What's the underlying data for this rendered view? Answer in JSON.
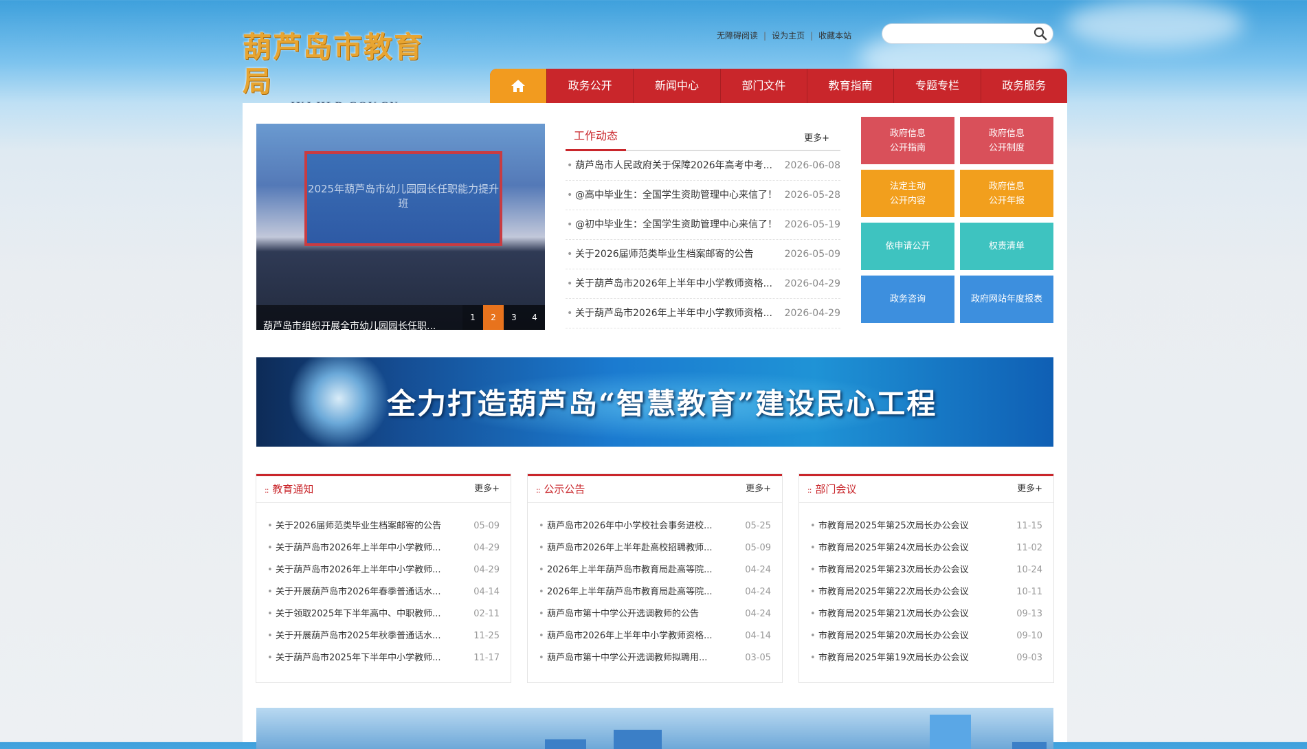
{
  "header": {
    "logo_cn": "葫芦岛市教育局",
    "logo_en": "JYJ.HLD.GOV.CN",
    "links": [
      "无障碍阅读",
      "设为主页",
      "收藏本站"
    ],
    "search_placeholder": ""
  },
  "nav": {
    "home_icon": "home-icon",
    "items": [
      "政务公开",
      "新闻中心",
      "部门文件",
      "教育指南",
      "专题专栏",
      "政务服务"
    ]
  },
  "slider": {
    "screen_text": "2025年葫芦岛市幼儿园园长任职能力提升班",
    "caption": "葫芦岛市组织开展全市幼儿园园长任职...",
    "pages": [
      "1",
      "2",
      "3",
      "4"
    ],
    "active_page": "2"
  },
  "news": {
    "tab": "工作动态",
    "more": "更多+",
    "items": [
      {
        "title": "葫芦岛市人民政府关于保障2026年高考中考...",
        "date": "2026-06-08"
      },
      {
        "title": "@高中毕业生：全国学生资助管理中心来信了！",
        "date": "2026-05-28"
      },
      {
        "title": "@初中毕业生：全国学生资助管理中心来信了！",
        "date": "2026-05-19"
      },
      {
        "title": "关于2026届师范类毕业生档案邮寄的公告",
        "date": "2026-05-09"
      },
      {
        "title": "关于葫芦岛市2026年上半年中小学教师资格...",
        "date": "2026-04-29"
      },
      {
        "title": "关于葫芦岛市2026年上半年中小学教师资格...",
        "date": "2026-04-29"
      }
    ]
  },
  "quick_links": [
    {
      "line1": "政府信息",
      "line2": "公开指南",
      "color": "#d9505a"
    },
    {
      "line1": "政府信息",
      "line2": "公开制度",
      "color": "#d9505a"
    },
    {
      "line1": "法定主动",
      "line2": "公开内容",
      "color": "#f29f1d"
    },
    {
      "line1": "政府信息",
      "line2": "公开年报",
      "color": "#f29f1d"
    },
    {
      "line1": "依申请公开",
      "line2": "",
      "color": "#3ec3c0"
    },
    {
      "line1": "权责清单",
      "line2": "",
      "color": "#3ec3c0"
    },
    {
      "line1": "政务咨询",
      "line2": "",
      "color": "#3d8fde"
    },
    {
      "line1": "政府网站年度报表",
      "line2": "",
      "color": "#3d8fde"
    }
  ],
  "banner": {
    "text": "全力打造葫芦岛“智慧教育”建设民心工程"
  },
  "boxes": [
    {
      "title": "教育通知",
      "more": "更多+",
      "items": [
        {
          "title": "关于2026届师范类毕业生档案邮寄的公告",
          "date": "05-09"
        },
        {
          "title": "关于葫芦岛市2026年上半年中小学教师...",
          "date": "04-29"
        },
        {
          "title": "关于葫芦岛市2026年上半年中小学教师...",
          "date": "04-29"
        },
        {
          "title": "关于开展葫芦岛市2026年春季普通话水...",
          "date": "04-14"
        },
        {
          "title": "关于领取2025年下半年高中、中职教师...",
          "date": "02-11"
        },
        {
          "title": "关于开展葫芦岛市2025年秋季普通话水...",
          "date": "11-25"
        },
        {
          "title": "关于葫芦岛市2025年下半年中小学教师...",
          "date": "11-17"
        }
      ]
    },
    {
      "title": "公示公告",
      "more": "更多+",
      "items": [
        {
          "title": "葫芦岛市2026年中小学校社会事务进校...",
          "date": "05-25"
        },
        {
          "title": "葫芦岛市2026年上半年赴高校招聘教师...",
          "date": "05-09"
        },
        {
          "title": "2026年上半年葫芦岛市教育局赴高等院...",
          "date": "04-24"
        },
        {
          "title": "2026年上半年葫芦岛市教育局赴高等院...",
          "date": "04-24"
        },
        {
          "title": "葫芦岛市第十中学公开选调教师的公告",
          "date": "04-24"
        },
        {
          "title": "葫芦岛市2026年上半年中小学教师资格...",
          "date": "04-14"
        },
        {
          "title": "葫芦岛市第十中学公开选调教师拟聘用...",
          "date": "03-05"
        }
      ]
    },
    {
      "title": "部门会议",
      "more": "更多+",
      "items": [
        {
          "title": "市教育局2025年第25次局长办公会议",
          "date": "11-15"
        },
        {
          "title": "市教育局2025年第24次局长办公会议",
          "date": "11-02"
        },
        {
          "title": "市教育局2025年第23次局长办公会议",
          "date": "10-24"
        },
        {
          "title": "市教育局2025年第22次局长办公会议",
          "date": "10-11"
        },
        {
          "title": "市教育局2025年第21次局长办公会议",
          "date": "09-13"
        },
        {
          "title": "市教育局2025年第20次局长办公会议",
          "date": "09-10"
        },
        {
          "title": "市教育局2025年第19次局长办公会议",
          "date": "09-03"
        }
      ]
    }
  ]
}
